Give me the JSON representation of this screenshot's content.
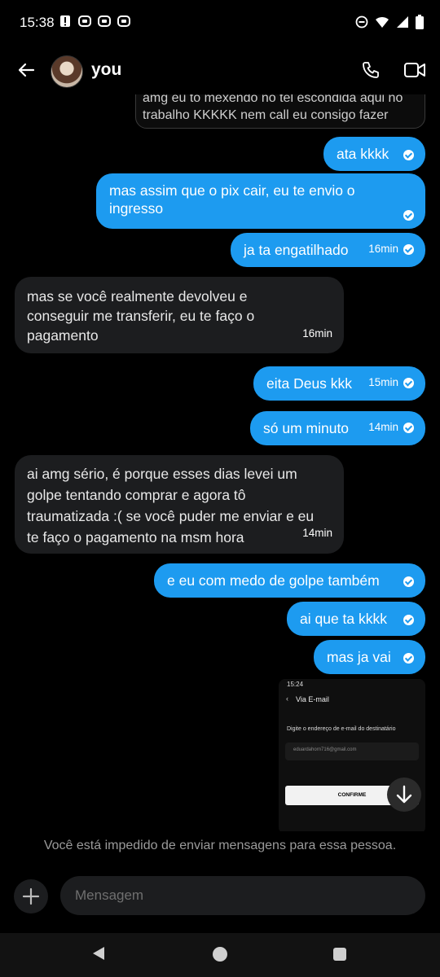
{
  "status": {
    "time": "15:38"
  },
  "header": {
    "name": "you"
  },
  "messages": {
    "quoted_text": "amg eu to mexendo no tel escondida aqui no trabalho KKKKK nem call eu consigo fazer",
    "m1": {
      "text": "ata kkkk"
    },
    "m2": {
      "text": "mas assim que o pix cair, eu te envio o ingresso"
    },
    "m3": {
      "text": "ja ta engatilhado",
      "time": "16min"
    },
    "m4": {
      "text": "mas se você realmente devolveu e conseguir me transferir, eu te faço o pagamento",
      "time": "16min"
    },
    "m5": {
      "text": "eita Deus kkk",
      "time": "15min"
    },
    "m6": {
      "text": "só um minuto",
      "time": "14min"
    },
    "m7": {
      "text": "ai amg sério, é porque esses dias levei um golpe tentando comprar e agora tô traumatizada :( se você puder me enviar e eu te faço o pagamento na msm hora",
      "time": "14min"
    },
    "m8": {
      "text": "e eu com medo de golpe também"
    },
    "m9": {
      "text": "ai que ta kkkk"
    },
    "m10": {
      "text": "mas ja vai"
    }
  },
  "attachment": {
    "time": "15:24",
    "title": "Via E-mail",
    "label": "Digite o endereço de e-mail do destinatário",
    "email": "eduardahorn716@gmail.com",
    "button": "CONFIRME"
  },
  "blocked_note": "Você está impedido de enviar mensagens para essa pessoa.",
  "composer": {
    "placeholder": "Mensagem"
  },
  "colors": {
    "outgoing": "#1d9bf0",
    "incoming": "#1c1d1f",
    "background": "#000000"
  }
}
